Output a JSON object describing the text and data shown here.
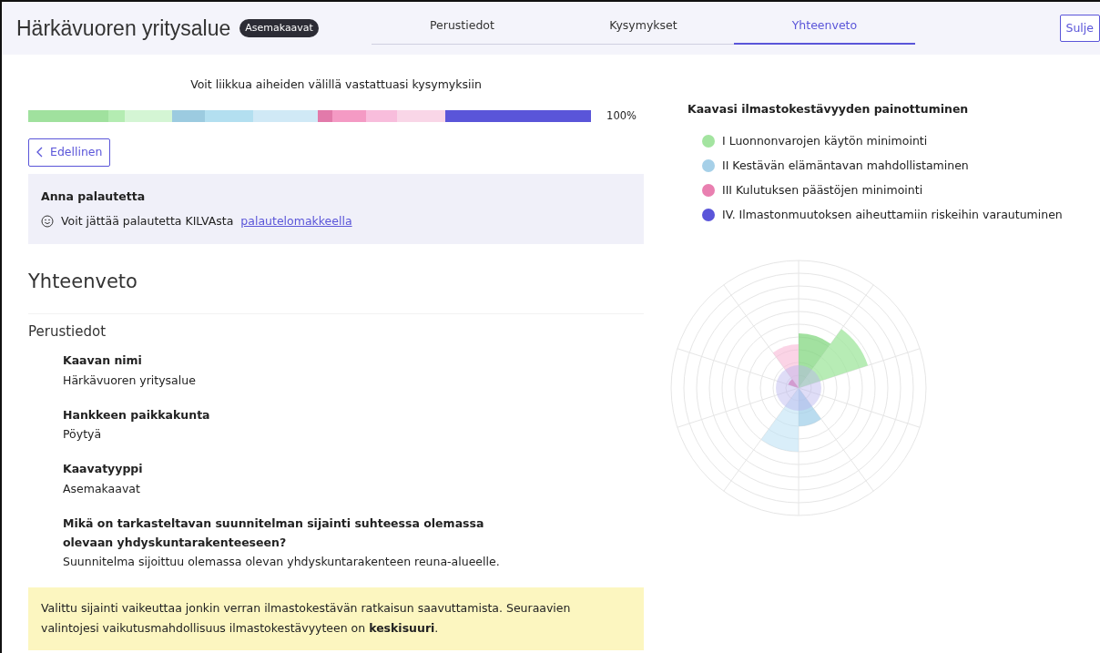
{
  "header": {
    "title": "Härkävuoren yritysalue",
    "badge": "Asemakaavat",
    "tabs": [
      {
        "label": "Perustiedot",
        "selected": false
      },
      {
        "label": "Kysymykset",
        "selected": false
      },
      {
        "label": "Yhteenveto",
        "selected": true
      }
    ],
    "close": "Sulje"
  },
  "progress": {
    "hint": "Voit liikkua aiheiden välillä vastattuasi kysymyksiin",
    "reading": "100%",
    "segments": [
      {
        "color": "#a0e19e"
      },
      {
        "color": "#b4ecb2"
      },
      {
        "color": "#d4f5d4"
      },
      {
        "color": "#9ccbe0"
      },
      {
        "color": "#b3dff0"
      },
      {
        "color": "#d0e9f6"
      },
      {
        "color": "#e27aaa"
      },
      {
        "color": "#f49ac4"
      },
      {
        "color": "#f8bddc"
      },
      {
        "color": "#f9d6e7"
      },
      {
        "color": "#5a55d9"
      }
    ]
  },
  "back_button": "Edellinen",
  "feedback": {
    "title": "Anna palautetta",
    "text": "Voit jättää palautetta KILVAsta",
    "link": "palautelomakkeella"
  },
  "summary": {
    "title": "Yhteenveto",
    "section": "Perustiedot",
    "fields": [
      {
        "label": "Kaavan nimi",
        "value": "Härkävuoren yritysalue"
      },
      {
        "label": "Hankkeen paikkakunta",
        "value": "Pöytyä"
      },
      {
        "label": "Kaavatyyppi",
        "value": "Asemakaavat"
      },
      {
        "label": "Mikä on tarkasteltavan suunnitelman sijainti suhteessa olemassa olevaan yhdyskuntarakenteeseen?",
        "value": "Suunnitelma sijoittuu olemassa olevan yhdyskuntarakenteen reuna-alueelle."
      }
    ],
    "note": "Valittu sijainti vaikeuttaa jonkin verran ilmastokestävän ratkaisun saavuttamista. Seuraavien valintojesi vaikutusmahdollisuus ilmastokestävyyteen on **keskisuuri**."
  },
  "chart_panel": {
    "title": "Kaavasi ilmastokestävyyden painottuminen",
    "legend": [
      {
        "label": "I Luonnonvarojen käytön minimointi",
        "color": "#a3e4a0"
      },
      {
        "label": "II Kestävän elämäntavan mahdollistaminen",
        "color": "#a6d0e8"
      },
      {
        "label": "III Kulutuksen päästöjen minimointi",
        "color": "#e97fb0"
      },
      {
        "label": "IV. Ilmastonmuutoksen aiheuttamiin riskeihin varautuminen",
        "color": "#5a55d9"
      }
    ]
  }
}
